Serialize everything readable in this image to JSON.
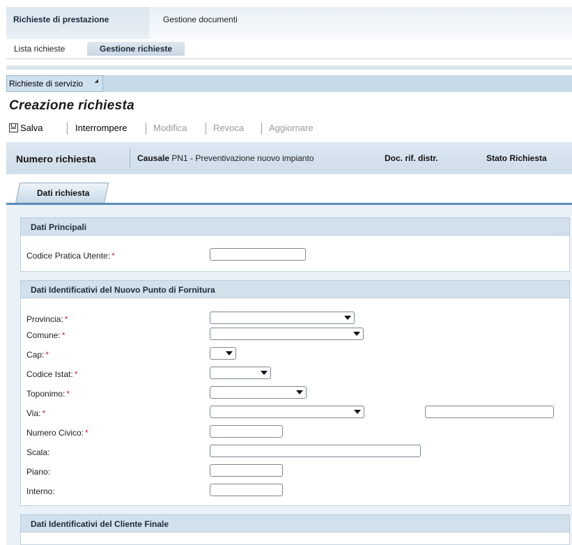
{
  "top_tabs": [
    "Richieste di prestazione",
    "Gestione documenti"
  ],
  "sub_tabs": [
    "Lista richieste",
    "Gestione richieste"
  ],
  "service_menu": "Richieste di servizio",
  "page_title": "Creazione richiesta",
  "toolbar": {
    "save": "Salva",
    "interrupt": "Interrompere",
    "modify": "Modifica",
    "revoke": "Revoca",
    "update": "Aggiornare"
  },
  "header": {
    "number_label": "Numero richiesta",
    "causale_label": "Causale",
    "causale_value": "PN1 - Preventivazione nuovo impianto",
    "doc_label": "Doc. rif. distr.",
    "status_label": "Stato Richiesta"
  },
  "content_tab": "Dati richiesta",
  "sections": {
    "main": {
      "title": "Dati Principali",
      "fields": {
        "codice_pratica": "Codice Pratica Utente:"
      }
    },
    "supply_point": {
      "title": "Dati Identificativi del Nuovo Punto di Fornitura",
      "fields": {
        "provincia": "Provincia:",
        "comune": "Comune:",
        "cap": "Cap:",
        "codice_istat": "Codice Istat:",
        "toponimo": "Toponimo:",
        "via": "Via:",
        "numero_civico": "Numero Civico:",
        "scala": "Scala:",
        "piano": "Piano:",
        "interno": "Interno:"
      }
    },
    "customer": {
      "title": "Dati Identificativi del Cliente Finale"
    }
  },
  "required_marker": "*",
  "colors": {
    "required": "#d8242a",
    "tab_accent": "#5a8bb7",
    "panel_bg": "#eaf1f7"
  }
}
